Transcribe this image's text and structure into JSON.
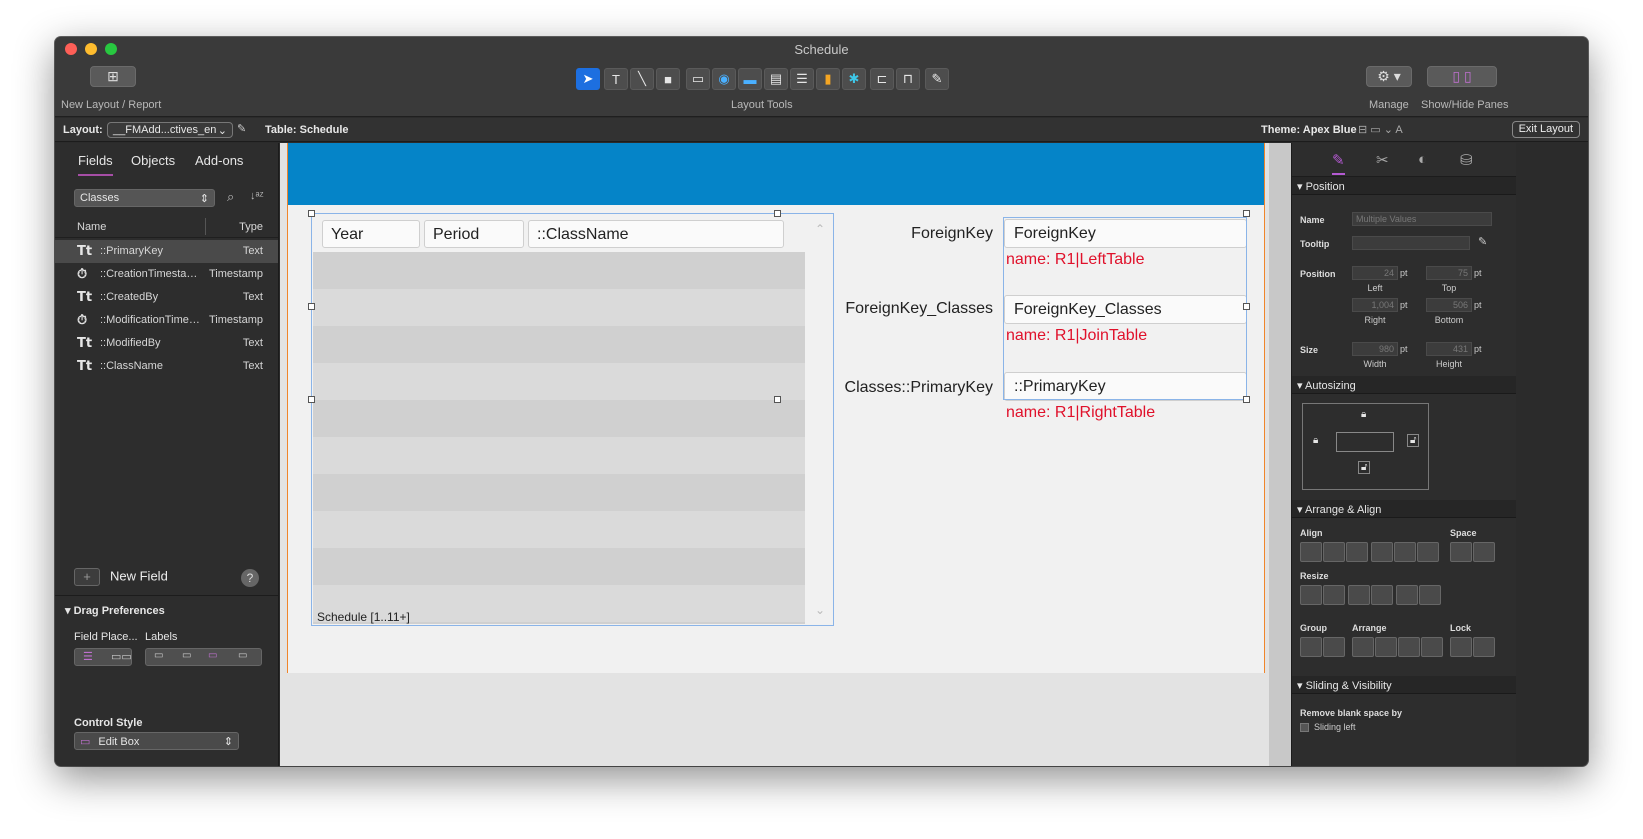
{
  "window": {
    "title": "Schedule"
  },
  "toolbar": {
    "new_layout_label": "New Layout / Report",
    "layout_tools_label": "Layout Tools",
    "manage_label": "Manage",
    "show_hide_label": "Show/Hide Panes"
  },
  "layoutbar": {
    "layout_label": "Layout:",
    "layout_value": "__FMAdd...ctives_en",
    "table_label": "Table: Schedule",
    "theme_label": "Theme: Apex Blue",
    "exit_label": "Exit Layout"
  },
  "leftpane": {
    "tabs": [
      "Fields",
      "Objects",
      "Add-ons"
    ],
    "table_select": "Classes",
    "col_name": "Name",
    "col_type": "Type",
    "fields": [
      {
        "icon": "Tt",
        "name": "::PrimaryKey",
        "type": "Text"
      },
      {
        "icon": "⏱",
        "name": "::CreationTimestamp",
        "type": "Timestamp"
      },
      {
        "icon": "Tt",
        "name": "::CreatedBy",
        "type": "Text"
      },
      {
        "icon": "⏱",
        "name": "::ModificationTimestamp",
        "type": "Timestamp"
      },
      {
        "icon": "Tt",
        "name": "::ModifiedBy",
        "type": "Text"
      },
      {
        "icon": "Tt",
        "name": "::ClassName",
        "type": "Text"
      }
    ],
    "new_field_label": "New Field",
    "drag_prefs_label": "Drag Preferences",
    "field_place_label": "Field Place...",
    "labels_label": "Labels",
    "control_style_label": "Control Style",
    "control_style_value": "Edit Box"
  },
  "canvas": {
    "portal_fields": [
      "Year",
      "Period",
      "::ClassName"
    ],
    "portal_label": "Schedule [1..11+]",
    "rows": [
      {
        "label": "ForeignKey",
        "field": "ForeignKey",
        "name": "name: R1|LeftTable"
      },
      {
        "label": "ForeignKey_Classes",
        "field": "ForeignKey_Classes",
        "name": "name: R1|JoinTable"
      },
      {
        "label": "Classes::PrimaryKey",
        "field": "::PrimaryKey",
        "name": "name: R1|RightTable"
      }
    ]
  },
  "inspector": {
    "position_section": "Position",
    "name_label": "Name",
    "name_placeholder": "Multiple Values",
    "tooltip_label": "Tooltip",
    "position_label": "Position",
    "left_value": "24",
    "top_value": "75",
    "right_value": "1,004",
    "bottom_value": "506",
    "left_label": "Left",
    "top_label": "Top",
    "right_label": "Right",
    "bottom_label": "Bottom",
    "size_label": "Size",
    "width_value": "980",
    "height_value": "431",
    "width_label": "Width",
    "height_label": "Height",
    "unit": "pt",
    "autosizing_section": "Autosizing",
    "arrange_section": "Arrange & Align",
    "align_label": "Align",
    "space_label": "Space",
    "resize_label": "Resize",
    "group_label": "Group",
    "arrange_label": "Arrange",
    "lock_label": "Lock",
    "sliding_section": "Sliding & Visibility",
    "remove_blank_label": "Remove blank space by",
    "sliding_left_label": "Sliding left"
  }
}
